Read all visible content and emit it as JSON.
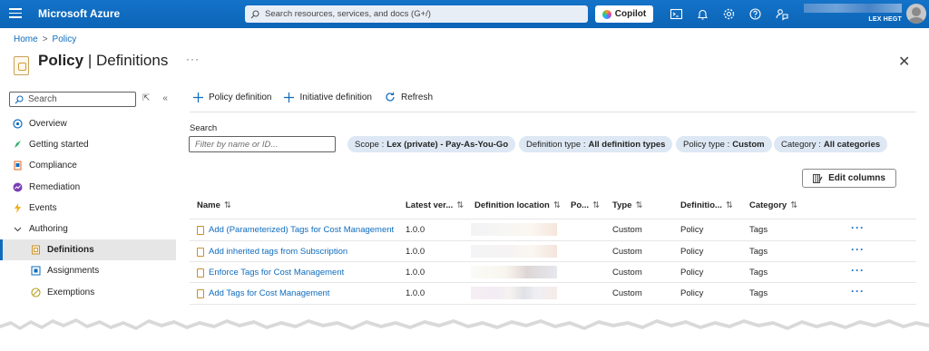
{
  "topbar": {
    "brand": "Microsoft Azure",
    "search_placeholder": "Search resources, services, and docs (G+/)",
    "copilot_label": "Copilot",
    "account_name": "LEX HEGT",
    "icons": [
      "cloud-shell-icon",
      "bell-icon",
      "gear-icon",
      "help-icon",
      "feedback-icon"
    ]
  },
  "breadcrumb": {
    "home": "Home",
    "current": "Policy"
  },
  "page": {
    "title_bold": "Policy",
    "title_rest": " | Definitions",
    "more": "···",
    "close": "✕"
  },
  "sidebar": {
    "search_placeholder": "Search",
    "items": [
      {
        "label": "Overview",
        "icon": "overview-icon",
        "level": 0
      },
      {
        "label": "Getting started",
        "icon": "rocket-icon",
        "level": 0
      },
      {
        "label": "Compliance",
        "icon": "compliance-icon",
        "level": 0
      },
      {
        "label": "Remediation",
        "icon": "remediation-icon",
        "level": 0
      },
      {
        "label": "Events",
        "icon": "lightning-icon",
        "level": 0
      },
      {
        "label": "Authoring",
        "icon": "chevron-down-icon",
        "level": 0
      },
      {
        "label": "Definitions",
        "icon": "definition-icon",
        "level": 1,
        "active": true
      },
      {
        "label": "Assignments",
        "icon": "assignment-icon",
        "level": 1
      },
      {
        "label": "Exemptions",
        "icon": "exemption-icon",
        "level": 1
      }
    ]
  },
  "toolbar": {
    "policy_definition": "Policy definition",
    "initiative_definition": "Initiative definition",
    "refresh": "Refresh"
  },
  "filters": {
    "search_label": "Search",
    "search_placeholder": "Filter by name or ID...",
    "pills": [
      {
        "key": "Scope :",
        "value": "Lex (private) - Pay-As-You-Go"
      },
      {
        "key": "Definition type :",
        "value": "All definition types"
      },
      {
        "key": "Policy type :",
        "value": "Custom"
      },
      {
        "key": "Category :",
        "value": "All categories"
      }
    ],
    "edit_columns": "Edit columns"
  },
  "table": {
    "columns": [
      "Name",
      "Latest ver...",
      "Definition location",
      "Po...",
      "Type",
      "Definitio...",
      "Category"
    ],
    "sort_glyph": "⇅",
    "rows": [
      {
        "name": "Add (Parameterized) Tags for Cost Management",
        "version": "1.0.0",
        "type": "Custom",
        "definition": "Policy",
        "category": "Tags"
      },
      {
        "name": "Add inherited tags from Subscription",
        "version": "1.0.0",
        "type": "Custom",
        "definition": "Policy",
        "category": "Tags"
      },
      {
        "name": "Enforce Tags for Cost Management",
        "version": "1.0.0",
        "type": "Custom",
        "definition": "Policy",
        "category": "Tags"
      },
      {
        "name": "Add Tags for Cost Management",
        "version": "1.0.0",
        "type": "Custom",
        "definition": "Policy",
        "category": "Tags"
      }
    ],
    "row_more": "···"
  },
  "colors": {
    "accent": "#0f6cbd",
    "topbar": "#0b64b6",
    "pill": "#dde8f4",
    "active_nav": "#e6e6e6"
  }
}
